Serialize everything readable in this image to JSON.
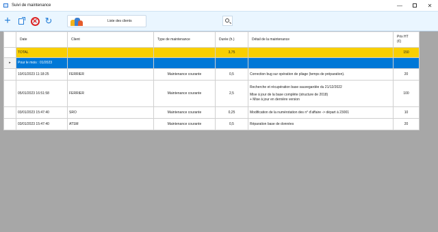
{
  "window": {
    "title": "Suivi de maintenance",
    "buttons": {
      "minimize": "—",
      "close": "✕"
    }
  },
  "toolbar": {
    "add_icon": "+",
    "refresh_icon": "↻",
    "delete_icon": "✕",
    "clients_button_label": "Liste des clients"
  },
  "grid": {
    "columns": {
      "date": "Date",
      "client": "Client",
      "type": "Type de maintenance",
      "duree": "Durée (h.)",
      "detail": "Détail de la maintenance",
      "prix_line1": "Prix HT",
      "prix_line2": "(€)"
    },
    "total": {
      "label": "TOTAL",
      "duree": "3,75",
      "prix": "150"
    },
    "month": {
      "label": "Pour le mois : 01/2023",
      "expander": "▸"
    },
    "rows": [
      {
        "date": "10/01/2023 11:18:25",
        "client": "FERRIER",
        "type": "Maintenance courante",
        "duree": "0,5",
        "detail": [
          "Correction bug sur opération de pliage (temps de préparation)."
        ],
        "prix": "20"
      },
      {
        "date": "05/01/2023 16:51:58",
        "client": "FERRIER",
        "type": "Maintenance courante",
        "duree": "2,5",
        "detail": [
          "Recherche et récupération base sauvegardée du 21/12/2022",
          "",
          "Mise à jour de la base complète (structure de 2018)",
          "+ Mise à jour en dernière version"
        ],
        "prix": "100"
      },
      {
        "date": "03/01/2023 15:47:40",
        "client": "SRO",
        "type": "Maintenance courante",
        "duree": "0,25",
        "detail": [
          "Modification de la numérotation des n° d'affaire -> départ à 23001"
        ],
        "prix": "10"
      },
      {
        "date": "03/01/2023 15:47:40",
        "client": "ATSM",
        "type": "Maintenance courante",
        "duree": "0,5",
        "detail": [
          "Réparation base de données"
        ],
        "prix": "20"
      }
    ]
  },
  "colors": {
    "total_row": "#f8cf02",
    "month_row": "#0078d7",
    "toolbar_bg": "#eaf6ff",
    "grid_background": "#a7a7a7"
  },
  "icons": [
    "app-icon",
    "add-icon",
    "export-icon",
    "delete-icon",
    "refresh-icon",
    "clients-list-icon",
    "search-icon"
  ]
}
